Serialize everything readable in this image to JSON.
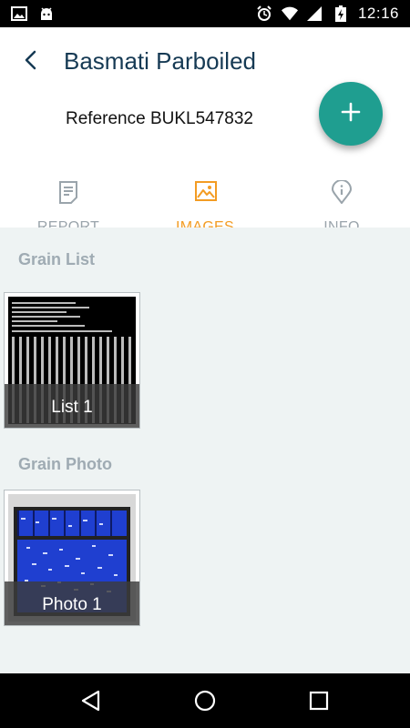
{
  "status_bar": {
    "time": "12:16",
    "left_icons": [
      "image-icon",
      "android-icon"
    ],
    "right_icons": [
      "alarm-icon",
      "wifi-icon",
      "signal-icon",
      "battery-charging-icon"
    ]
  },
  "header": {
    "title": "Basmati Parboiled",
    "reference": "Reference BUKL547832",
    "fab_icon": "plus-icon"
  },
  "tabs": [
    {
      "label": "REPORT",
      "icon": "report-icon",
      "active": false
    },
    {
      "label": "IMAGES",
      "icon": "image-icon",
      "active": true
    },
    {
      "label": "INFO",
      "icon": "info-pin-icon",
      "active": false
    }
  ],
  "sections": {
    "grain_list": {
      "title": "Grain List",
      "items": [
        {
          "caption": "List 1"
        }
      ]
    },
    "grain_photo": {
      "title": "Grain Photo",
      "items": [
        {
          "caption": "Photo 1"
        }
      ]
    }
  },
  "colors": {
    "accent": "#1f9e90",
    "tab_active": "#f39c23",
    "title": "#163a54",
    "content_bg": "#eef3f3"
  },
  "nav": [
    "back-triangle-icon",
    "home-circle-icon",
    "recents-square-icon"
  ]
}
